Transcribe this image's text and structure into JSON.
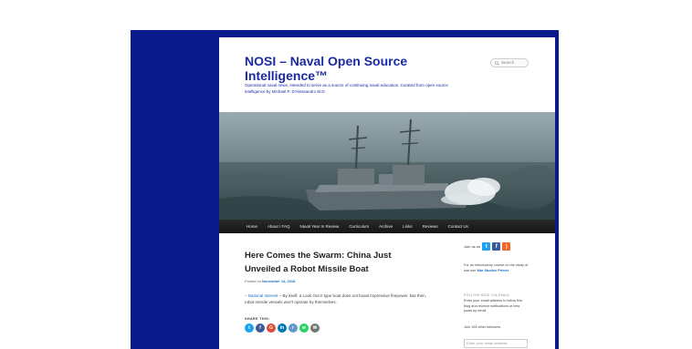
{
  "site": {
    "title": "NOSI – Naval Open Source Intelligence™",
    "tagline": "Operational naval news, intended to serve as a source of continuing naval education. Curated from open source intelligence by Michael P. D'Alessandro M.D."
  },
  "search": {
    "placeholder": "Search"
  },
  "nav": {
    "items": [
      "Home",
      "About / FAQ",
      "Naval Year In Review",
      "Curriculum",
      "Archive",
      "Links",
      "Reviews",
      "Contact Us"
    ]
  },
  "post": {
    "title": "Here Comes the Swarm: China Just Unveiled a Robot Missile Boat",
    "posted_on": "Posted on",
    "date": "November 14, 2018",
    "source": "– National Interest",
    "excerpt": " – By itself, a Look Out II type boat does not boast impressive firepower. But then, robot missile vessels won't operate by themselves.",
    "share_label": "SHARE THIS:"
  },
  "share_buttons": [
    {
      "name": "twitter",
      "glyph": "t",
      "color": "#1da1f2"
    },
    {
      "name": "facebook",
      "glyph": "f",
      "color": "#3b5998"
    },
    {
      "name": "google-plus",
      "glyph": "G",
      "color": "#dd4b39"
    },
    {
      "name": "linkedin",
      "glyph": "in",
      "color": "#0077b5"
    },
    {
      "name": "reddit",
      "glyph": "r",
      "color": "#5f99cf"
    },
    {
      "name": "whatsapp",
      "glyph": "w",
      "color": "#25d366"
    },
    {
      "name": "email",
      "glyph": "✉",
      "color": "#777777"
    }
  ],
  "sidebar": {
    "join_text": "Join us on",
    "intro_prefix": "For an introductory course on the study of war see",
    "intro_link": "War Studies Primer",
    "follow_title": "FOLLOW NOSI VIA EMAIL",
    "follow_desc": "Enter your email address to follow this blog and receive notifications of new posts by email.",
    "followers": "Join 194 other followers",
    "email_placeholder": "Enter your email address"
  },
  "colors": {
    "band": "#0a1c8c",
    "title": "#1a2aa0",
    "link": "#1b6fc4",
    "nav_bg": "#1e1e1e"
  }
}
